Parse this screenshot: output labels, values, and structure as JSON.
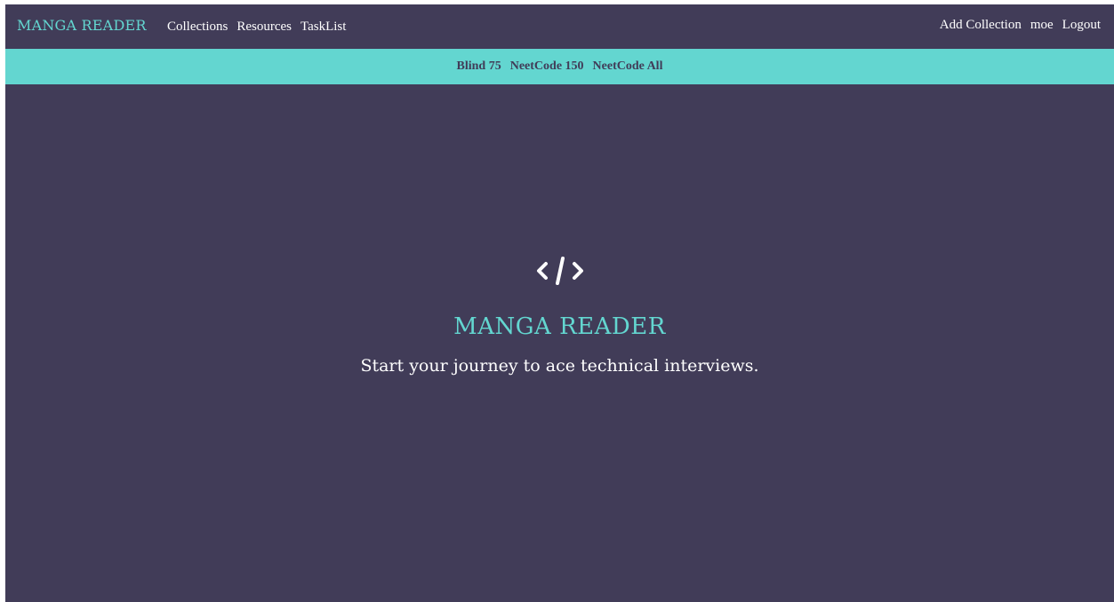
{
  "colors": {
    "background": "#413c58",
    "accent": "#63d6d0",
    "text": "#ffffff"
  },
  "header": {
    "brand": "MANGA READER",
    "nav": [
      "Collections",
      "Resources",
      "TaskList"
    ],
    "right_nav": [
      "Add Collection",
      "moe",
      "Logout"
    ]
  },
  "subnav": {
    "links": [
      "Blind 75",
      "NeetCode 150",
      "NeetCode All"
    ]
  },
  "hero": {
    "icon": "code-icon",
    "title": "MANGA READER",
    "subtitle": "Start your journey to ace technical interviews."
  }
}
